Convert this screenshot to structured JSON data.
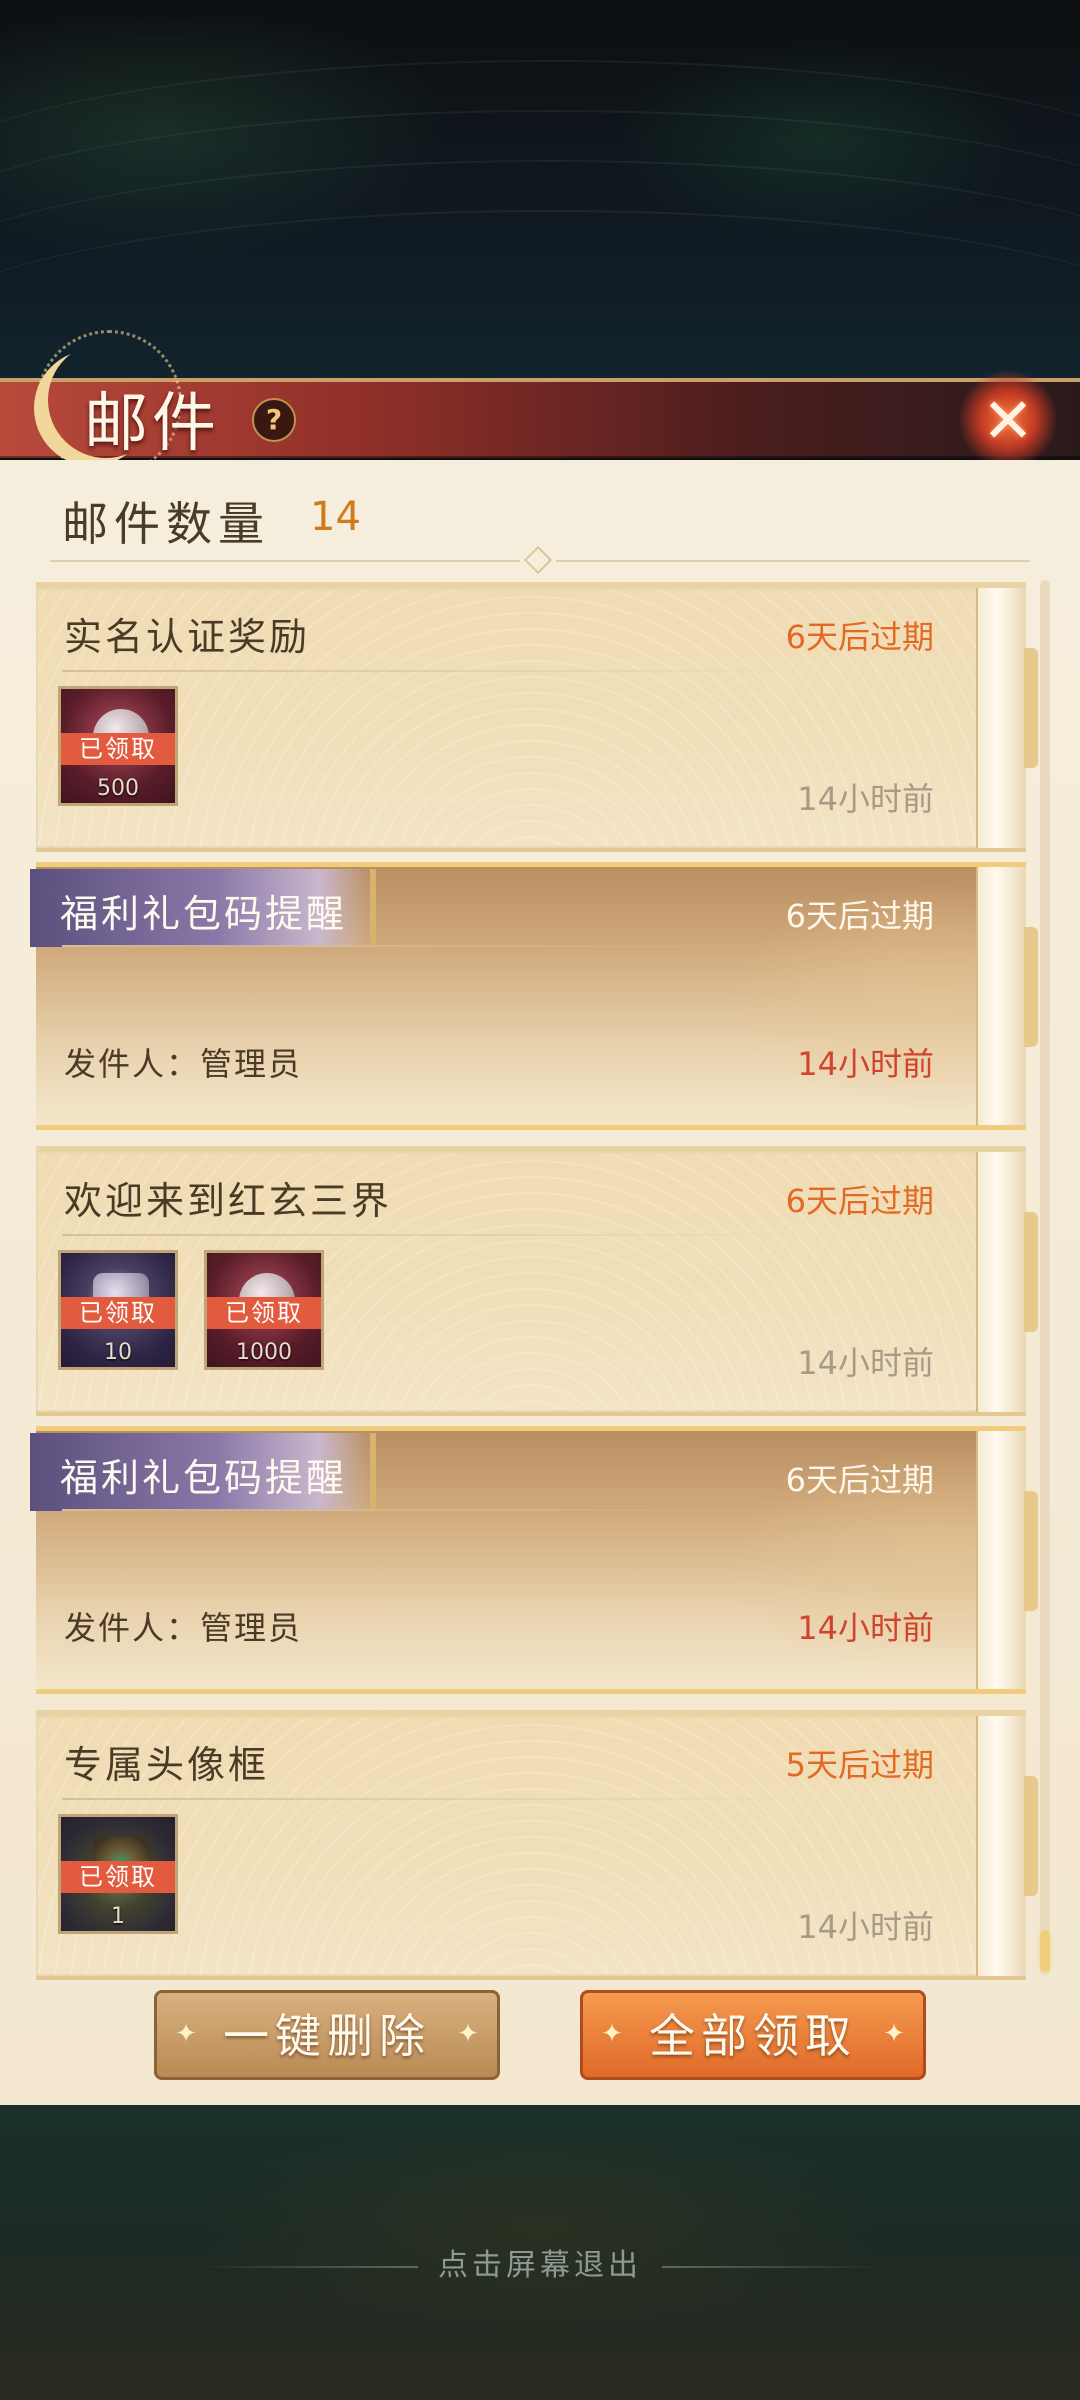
{
  "header": {
    "title": "邮件",
    "help_icon": "?",
    "close_icon": "✕"
  },
  "summary": {
    "count_label": "邮件数量",
    "count_value": "14"
  },
  "mails": [
    {
      "subject": "实名认证奖励",
      "expire": "6天后过期",
      "time": "14小时前",
      "type": "reward",
      "rewards": [
        {
          "status": "已领取",
          "qty": "500",
          "icon": "red-gem-icon"
        }
      ]
    },
    {
      "subject": "福利礼包码提醒",
      "expire": "6天后过期",
      "time": "14小时前",
      "type": "notice",
      "sender": "发件人：管理员"
    },
    {
      "subject": "欢迎来到红玄三界",
      "expire": "6天后过期",
      "time": "14小时前",
      "type": "reward",
      "rewards": [
        {
          "status": "已领取",
          "qty": "10",
          "icon": "scroll-item-icon"
        },
        {
          "status": "已领取",
          "qty": "1000",
          "icon": "red-gem-icon"
        }
      ]
    },
    {
      "subject": "福利礼包码提醒",
      "expire": "6天后过期",
      "time": "14小时前",
      "type": "notice",
      "sender": "发件人：管理员"
    },
    {
      "subject": "专属头像框",
      "expire": "5天后过期",
      "time": "14小时前",
      "type": "reward",
      "rewards": [
        {
          "status": "已领取",
          "qty": "1",
          "icon": "avatar-frame-icon"
        }
      ]
    }
  ],
  "actions": {
    "delete_all": "一键删除",
    "claim_all": "全部领取"
  },
  "footer": {
    "exit_hint": "点击屏幕退出"
  },
  "colors": {
    "accent_orange": "#e26a24",
    "time_red": "#d0442a",
    "panel_bg": "#f6eedd"
  }
}
